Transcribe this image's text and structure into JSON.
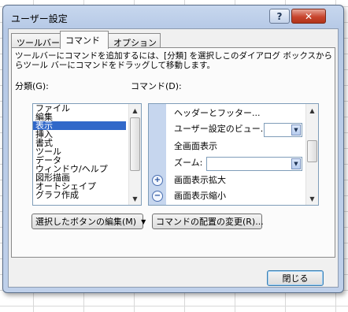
{
  "dialog": {
    "title": "ユーザー設定",
    "help_label": "?",
    "close_label": "✕",
    "close_button": "閉じる"
  },
  "tabs": [
    {
      "label": "ツールバー",
      "active": false
    },
    {
      "label": "コマンド",
      "active": true
    },
    {
      "label": "オプション",
      "active": false
    }
  ],
  "description": "ツールバーにコマンドを追加するには、[分類] を選択しこのダイアログ ボックスから\nらツール バーにコマンドをドラッグして移動します。",
  "categories": {
    "label": "分類(G):",
    "items": [
      "ファイル",
      "編集",
      "表示",
      "挿入",
      "書式",
      "ツール",
      "データ",
      "ウィンドウ/ヘルプ",
      "図形描画",
      "オートシェイプ",
      "グラフ作成"
    ],
    "selected": "表示"
  },
  "commands": {
    "label": "コマンド(D):",
    "items": [
      {
        "label": "ヘッダーとフッター...",
        "icon": "",
        "has_combo": false
      },
      {
        "label": "ユーザー設定のビュー...",
        "icon": "",
        "has_combo": true
      },
      {
        "label": "全画面表示",
        "icon": "",
        "has_combo": false
      },
      {
        "label": "ズーム:",
        "icon": "",
        "has_combo": true
      },
      {
        "label": "画面表示拡大",
        "icon": "zoom-in-icon",
        "has_combo": false
      },
      {
        "label": "画面表示縮小",
        "icon": "zoom-out-icon",
        "has_combo": false
      }
    ]
  },
  "buttons": {
    "modify_selection": "選択したボタンの編集(M)",
    "rearrange_commands": "コマンドの配置の変更(R)..."
  },
  "colors": {
    "selection": "#3168c9",
    "icon_gutter": "#c6d6ee",
    "title_bar": "#bfd0ea"
  }
}
